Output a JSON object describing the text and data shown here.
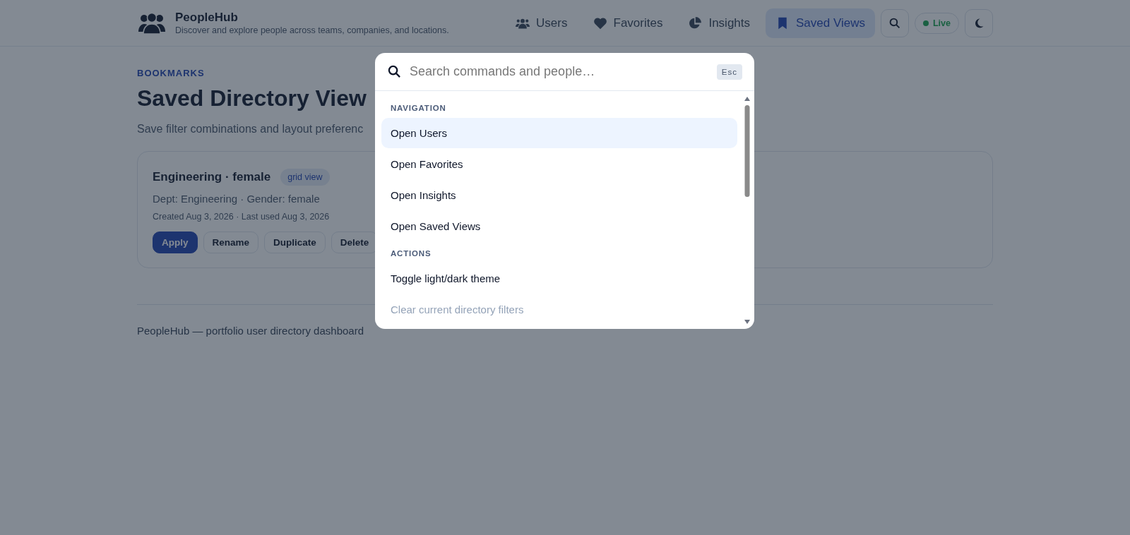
{
  "brand": {
    "name": "PeopleHub",
    "tagline": "Discover and explore people across teams, companies, and locations."
  },
  "nav": [
    {
      "label": "Users",
      "selected": false
    },
    {
      "label": "Favorites",
      "selected": false
    },
    {
      "label": "Insights",
      "selected": false
    },
    {
      "label": "Saved Views",
      "selected": true
    }
  ],
  "status": {
    "label": "Live",
    "color": "#1a6042"
  },
  "page": {
    "eyebrow": "BOOKMARKS",
    "title": "Saved Directory View",
    "subtitle": "Save filter combinations and layout preferenc"
  },
  "saved_view": {
    "name": "Engineering · female",
    "tag": "grid view",
    "filters": "Dept: Engineering · Gender: female",
    "dates": "Created Aug 3, 2026 · Last used Aug 3, 2026",
    "actions": [
      {
        "label": "Apply",
        "kind": "primary"
      },
      {
        "label": "Rename",
        "kind": "secondary"
      },
      {
        "label": "Duplicate",
        "kind": "secondary"
      },
      {
        "label": "Delete",
        "kind": "secondary"
      }
    ]
  },
  "footer": "PeopleHub — portfolio user directory dashboard",
  "palette": {
    "search": {
      "placeholder": "Search commands and people…"
    },
    "shortcut": "Esc",
    "sections": [
      {
        "heading": "NAVIGATION",
        "items": [
          {
            "label": "Open Users",
            "selected": true,
            "disabled": false
          },
          {
            "label": "Open Favorites",
            "selected": false,
            "disabled": false
          },
          {
            "label": "Open Insights",
            "selected": false,
            "disabled": false
          },
          {
            "label": "Open Saved Views",
            "selected": false,
            "disabled": false
          }
        ]
      },
      {
        "heading": "ACTIONS",
        "items": [
          {
            "label": "Toggle light/dark theme",
            "selected": false,
            "disabled": false
          },
          {
            "label": "Clear current directory filters",
            "selected": false,
            "disabled": true
          }
        ]
      }
    ]
  }
}
